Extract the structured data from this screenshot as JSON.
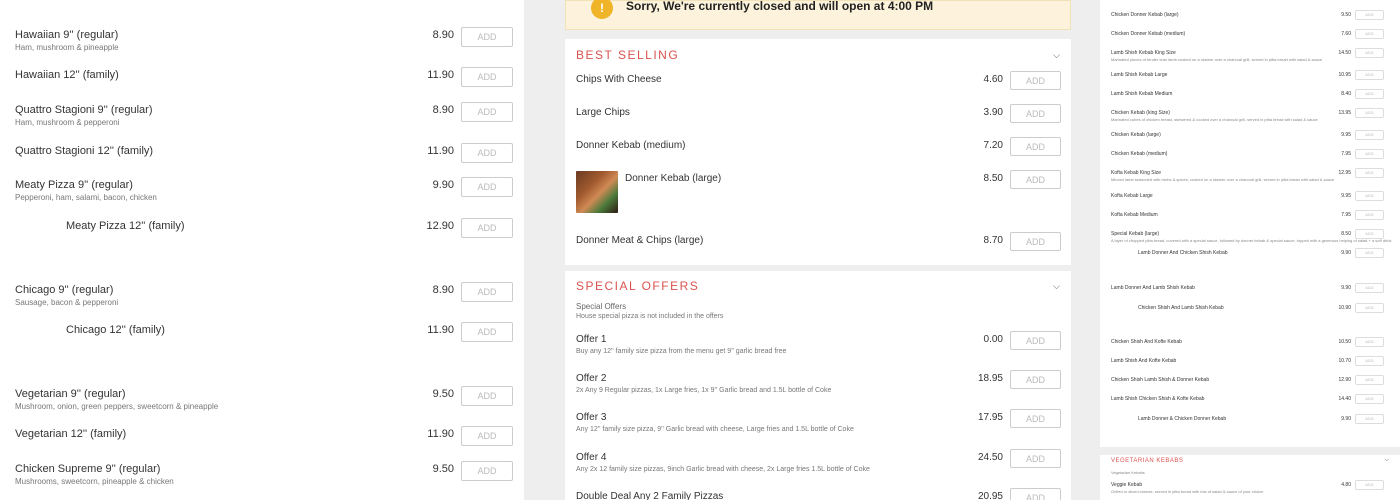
{
  "left_items": [
    {
      "name": "Hawaiian 9'' (regular)",
      "desc": "Ham, mushroom & pineapple",
      "price": "8.90",
      "add": "ADD"
    },
    {
      "name": "Hawaiian 12'' (family)",
      "desc": "",
      "price": "11.90",
      "add": "ADD"
    },
    {
      "name": "Quattro Stagioni 9'' (regular)",
      "desc": "Ham, mushroom & pepperoni",
      "price": "8.90",
      "add": "ADD"
    },
    {
      "name": "Quattro Stagioni 12'' (family)",
      "desc": "",
      "price": "11.90",
      "add": "ADD"
    },
    {
      "name": "Meaty Pizza 9'' (regular)",
      "desc": "Pepperoni, ham, salami, bacon, chicken",
      "price": "9.90",
      "add": "ADD"
    },
    {
      "name": "Meaty Pizza 12'' (family)",
      "desc": "",
      "price": "12.90",
      "add": "ADD"
    },
    {
      "name": "Chicago 9'' (regular)",
      "desc": "Sausage, bacon & pepperoni",
      "price": "8.90",
      "add": "ADD"
    },
    {
      "name": "Chicago 12'' (family)",
      "desc": "",
      "price": "11.90",
      "add": "ADD"
    },
    {
      "name": "Vegetarian 9'' (regular)",
      "desc": "Mushroom, onion, green peppers, sweetcorn & pineapple",
      "price": "9.50",
      "add": "ADD"
    },
    {
      "name": "Vegetarian 12'' (family)",
      "desc": "",
      "price": "11.90",
      "add": "ADD"
    },
    {
      "name": "Chicken Supreme 9'' (regular)",
      "desc": "Mushrooms, sweetcorn, pineapple & chicken",
      "price": "9.50",
      "add": "ADD"
    }
  ],
  "notice": {
    "icon": "!",
    "text": "Sorry, We're currently closed and will open at 4:00 PM"
  },
  "best_selling": {
    "title": "BEST SELLING",
    "items": [
      {
        "name": "Chips With Cheese",
        "price": "4.60",
        "add": "ADD"
      },
      {
        "name": "Large Chips",
        "price": "3.90",
        "add": "ADD"
      },
      {
        "name": "Donner Kebab (medium)",
        "price": "7.20",
        "add": "ADD"
      },
      {
        "name": "Donner Kebab (large)",
        "price": "8.50",
        "add": "ADD"
      },
      {
        "name": "Donner Meat & Chips (large)",
        "price": "8.70",
        "add": "ADD"
      }
    ]
  },
  "special_offers": {
    "title": "SPECIAL OFFERS",
    "intro_title": "Special Offers",
    "intro_desc": "House special pizza is not included in the offers",
    "items": [
      {
        "name": "Offer 1",
        "desc": "Buy any 12'' family size pizza from the menu get 9'' garlic bread free",
        "price": "0.00",
        "add": "ADD"
      },
      {
        "name": "Offer 2",
        "desc": "2x Any 9 Regular pizzas, 1x Large fries, 1x 9'' Garlic bread and 1.5L bottle of Coke",
        "price": "18.95",
        "add": "ADD"
      },
      {
        "name": "Offer 3",
        "desc": "Any 12'' family size pizza, 9'' Garlic bread with cheese, Large fries and 1.5L bottle of Coke",
        "price": "17.95",
        "add": "ADD"
      },
      {
        "name": "Offer 4",
        "desc": "Any 2x 12 family size pizzas, 9inch Garlic bread with cheese, 2x Large fries 1.5L bottle of Coke",
        "price": "24.50",
        "add": "ADD"
      },
      {
        "name": "Double Deal Any 2 Family Pizzas",
        "desc": "",
        "price": "20.95",
        "add": "ADD"
      }
    ]
  },
  "right_items": [
    {
      "name": "Chicken Donner Kebab (large)",
      "desc": "",
      "price": "9.50",
      "add": "ADD"
    },
    {
      "name": "Chicken Donner Kebab (medium)",
      "desc": "",
      "price": "7.60",
      "add": "ADD"
    },
    {
      "name": "Lamb Shish Kebab King Size",
      "desc": "Marinated pieces of tender lean lamb cooked on a skewer over a charcoal grill, served in pitta bread with salad & sauce",
      "price": "14.50",
      "add": "ADD"
    },
    {
      "name": "Lamb Shish Kebab Large",
      "desc": "",
      "price": "10.95",
      "add": "ADD"
    },
    {
      "name": "Lamb Shish Kebab Medium",
      "desc": "",
      "price": "8.40",
      "add": "ADD"
    },
    {
      "name": "Chicken Kebab (king Size)",
      "desc": "Marinated cubes of chicken breast, skewered & cooked over a charcoal grill, served in pitta bread with salad & sauce",
      "price": "13.95",
      "add": "ADD"
    },
    {
      "name": "Chicken Kebab (large)",
      "desc": "",
      "price": "9.95",
      "add": "ADD"
    },
    {
      "name": "Chicken Kebab (medium)",
      "desc": "",
      "price": "7.95",
      "add": "ADD"
    },
    {
      "name": "Kofta Kebab King Size",
      "desc": "Minced lamb seasoned with herbs & spices, cooked on a skewer over a charcoal grill, served in pitta bread with salad & sauce",
      "price": "12.95",
      "add": "ADD"
    },
    {
      "name": "Kofta Kebab Large",
      "desc": "",
      "price": "9.95",
      "add": "ADD"
    },
    {
      "name": "Kofta Kebab Medium",
      "desc": "",
      "price": "7.95",
      "add": "ADD"
    },
    {
      "name": "Special Kebab (large)",
      "desc": "A layer of chopped pitta bread, covered with a special sauce, followed by donner kebab & special sauce, topped with a generous helping of salad + a soft drink",
      "price": "8.50",
      "add": "ADD"
    },
    {
      "name": "Lamb Donner And Chicken Shish Kebab",
      "desc": "",
      "price": "9.90",
      "add": "ADD"
    },
    {
      "name": "Lamb Donner And Lamb Shish Kebab",
      "desc": "",
      "price": "9.90",
      "add": "ADD"
    },
    {
      "name": "Chicken Shish And Lamb Shish Kebab",
      "desc": "",
      "price": "10.90",
      "add": "ADD"
    },
    {
      "name": "Chicken Shish And Kofte Kebab",
      "desc": "",
      "price": "10.50",
      "add": "ADD"
    },
    {
      "name": "Lamb Shish And Kofte Kebab",
      "desc": "",
      "price": "10.70",
      "add": "ADD"
    },
    {
      "name": "Chicken Shish Lamb Shish & Donner Kebab",
      "desc": "",
      "price": "12.90",
      "add": "ADD"
    },
    {
      "name": "Lamb Shish Chicken Shish & Kofte Kebab",
      "desc": "",
      "price": "14.40",
      "add": "ADD"
    },
    {
      "name": "Lamb Donner & Chicken Donner Kebab",
      "desc": "",
      "price": "9.90",
      "add": "ADD"
    }
  ],
  "vegetarian_kebabs": {
    "title": "VEGETARIAN KEBABS",
    "intro": "Vegetarian Kebabs",
    "items": [
      {
        "name": "Veggie Kebab",
        "desc": "Grilled or sliced cheese, served in pitta bread with lots of salad & sauce of your choice",
        "price": "4.80",
        "add": "ADD"
      }
    ]
  }
}
